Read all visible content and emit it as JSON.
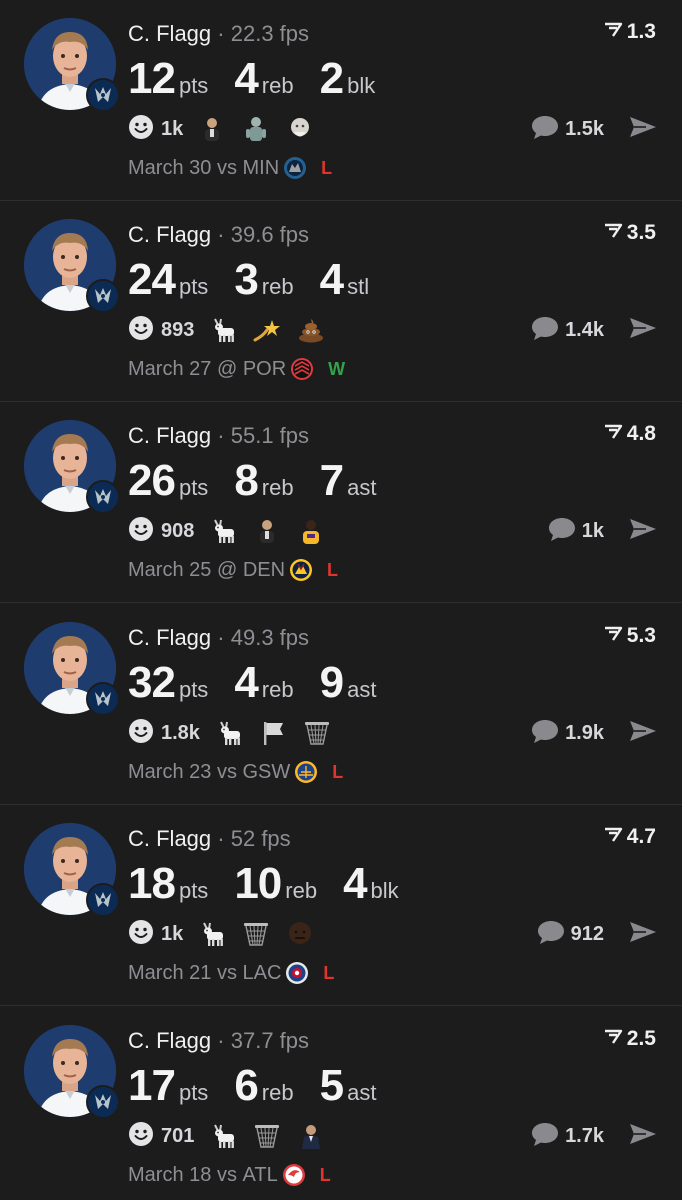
{
  "colors": {
    "background": "#1c1c1d",
    "loss": "#e0342c",
    "win": "#35a24a",
    "muted": "#8e8e93"
  },
  "posts": [
    {
      "player": "C. Flagg",
      "separator": "·",
      "fps": "22.3 fps",
      "score": "1.3",
      "stats": [
        {
          "value": "12",
          "label": "pts"
        },
        {
          "value": "4",
          "label": "reb"
        },
        {
          "value": "2",
          "label": "blk"
        }
      ],
      "reactions": {
        "count": "1k",
        "emojis": [
          "player-icon",
          "statue-icon",
          "old-man-icon"
        ]
      },
      "comments": "1.5k",
      "date": "March 30",
      "venue": "vs",
      "opponent": "MIN",
      "opponent_logo": "wolves-logo-icon",
      "result": "L"
    },
    {
      "player": "C. Flagg",
      "separator": "·",
      "fps": "39.6 fps",
      "score": "3.5",
      "stats": [
        {
          "value": "24",
          "label": "pts"
        },
        {
          "value": "3",
          "label": "reb"
        },
        {
          "value": "4",
          "label": "stl"
        }
      ],
      "reactions": {
        "count": "893",
        "emojis": [
          "goat-icon",
          "shooting-star-icon",
          "poop-icon"
        ]
      },
      "comments": "1.4k",
      "date": "March 27",
      "venue": "@",
      "opponent": "POR",
      "opponent_logo": "blazers-logo-icon",
      "result": "W"
    },
    {
      "player": "C. Flagg",
      "separator": "·",
      "fps": "55.1 fps",
      "score": "4.8",
      "stats": [
        {
          "value": "26",
          "label": "pts"
        },
        {
          "value": "8",
          "label": "reb"
        },
        {
          "value": "7",
          "label": "ast"
        }
      ],
      "reactions": {
        "count": "908",
        "emojis": [
          "goat-icon",
          "player-icon",
          "lakers-player-icon"
        ]
      },
      "comments": "1k",
      "date": "March 25",
      "venue": "@",
      "opponent": "DEN",
      "opponent_logo": "nuggets-logo-icon",
      "result": "L"
    },
    {
      "player": "C. Flagg",
      "separator": "·",
      "fps": "49.3 fps",
      "score": "5.3",
      "stats": [
        {
          "value": "32",
          "label": "pts"
        },
        {
          "value": "4",
          "label": "reb"
        },
        {
          "value": "9",
          "label": "ast"
        }
      ],
      "reactions": {
        "count": "1.8k",
        "emojis": [
          "goat-icon",
          "white-flag-icon",
          "basketball-net-icon"
        ]
      },
      "comments": "1.9k",
      "date": "March 23",
      "venue": "vs",
      "opponent": "GSW",
      "opponent_logo": "warriors-logo-icon",
      "result": "L"
    },
    {
      "player": "C. Flagg",
      "separator": "·",
      "fps": "52 fps",
      "score": "4.7",
      "stats": [
        {
          "value": "18",
          "label": "pts"
        },
        {
          "value": "10",
          "label": "reb"
        },
        {
          "value": "4",
          "label": "blk"
        }
      ],
      "reactions": {
        "count": "1k",
        "emojis": [
          "goat-icon",
          "basketball-net-icon",
          "face-icon"
        ]
      },
      "comments": "912",
      "date": "March 21",
      "venue": "vs",
      "opponent": "LAC",
      "opponent_logo": "clippers-logo-icon",
      "result": "L"
    },
    {
      "player": "C. Flagg",
      "separator": "·",
      "fps": "37.7 fps",
      "score": "2.5",
      "stats": [
        {
          "value": "17",
          "label": "pts"
        },
        {
          "value": "6",
          "label": "reb"
        },
        {
          "value": "5",
          "label": "ast"
        }
      ],
      "reactions": {
        "count": "701",
        "emojis": [
          "goat-icon",
          "basketball-net-icon",
          "suit-man-icon"
        ]
      },
      "comments": "1.7k",
      "date": "March 18",
      "venue": "vs",
      "opponent": "ATL",
      "opponent_logo": "hawks-logo-icon",
      "result": "L"
    }
  ]
}
